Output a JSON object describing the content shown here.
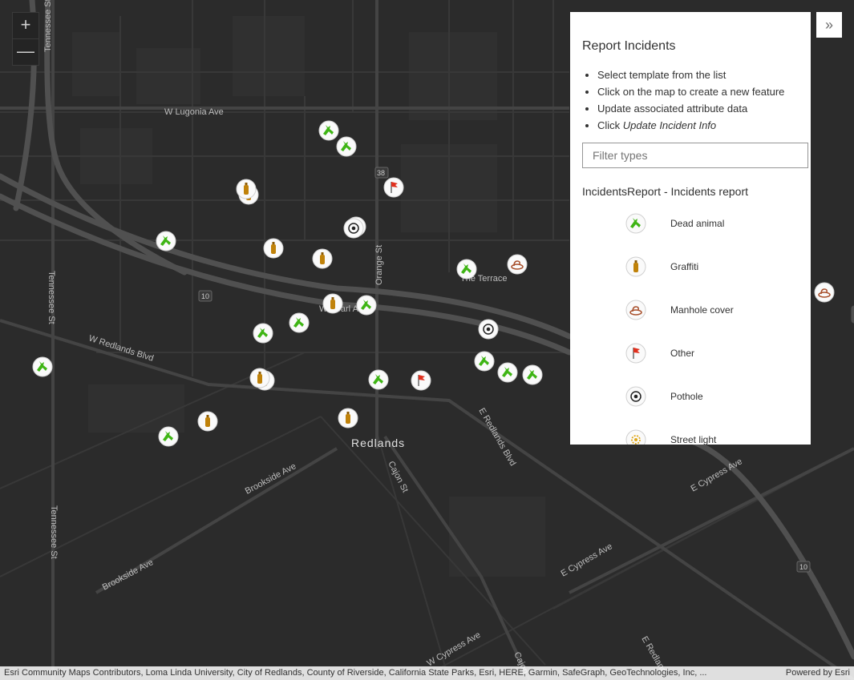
{
  "map": {
    "city_label": "Redlands",
    "road_labels": {
      "w_lugonia": "W Lugonia Ave",
      "w_redlands_blvd": "W Redlands Blvd",
      "w_pearl": "W Pearl Ave",
      "orange_st": "Orange St",
      "brookside_1": "Brookside Ave",
      "brookside_2": "Brookside Ave",
      "tennessee_top": "Tennessee St",
      "tennessee_mid": "Tennessee St",
      "tennessee_bot": "Tennessee St",
      "e_redlands_blvd": "E Redlands Blvd",
      "cajon": "Cajon St",
      "e_cypress_1": "E Cypress Ave",
      "e_cypress_2": "E Cypress Ave",
      "w_cypress": "W Cypress Ave",
      "the_terrace": "The Terrace",
      "e_redlands_bottom": "E Redlands",
      "cajon_bottom": "Cajon",
      "shield_10_left": "10",
      "shield_10_right": "10",
      "shield_38": "38"
    },
    "colors": {
      "background": "#2b2b2b",
      "road": "#3c3c3c",
      "freeway": "#484848",
      "dead_animal": "#3fb515",
      "graffiti": "#c0820a",
      "other_flag": "#e0301e",
      "manhole": "#a8502c"
    }
  },
  "zoom": {
    "in_label": "+",
    "out_label": "—"
  },
  "expand": {
    "icon": "double-chevron-right-icon",
    "label": "»"
  },
  "panel": {
    "title": "Report Incidents",
    "instructions": [
      "Select template from the list",
      "Click on the map to create a new feature",
      "Update associated attribute data",
      "Click "
    ],
    "instruction_emphasis": "Update Incident Info",
    "filter_placeholder": "Filter types",
    "group_title": "IncidentsReport - Incidents report",
    "templates": [
      {
        "label": "Dead animal",
        "icon": "dead-animal-icon"
      },
      {
        "label": "Graffiti",
        "icon": "graffiti-icon"
      },
      {
        "label": "Manhole cover",
        "icon": "manhole-icon"
      },
      {
        "label": "Other",
        "icon": "flag-icon"
      },
      {
        "label": "Pothole",
        "icon": "pothole-icon"
      },
      {
        "label": "Street light",
        "icon": "street-light-icon"
      }
    ]
  },
  "attribution": {
    "sources": "Esri Community Maps Contributors, Loma Linda University, City of Redlands, County of Riverside, California State Parks, Esri, HERE, Garmin, SafeGraph, GeoTechnologies, Inc, ...",
    "powered_by": "Powered by Esri"
  }
}
